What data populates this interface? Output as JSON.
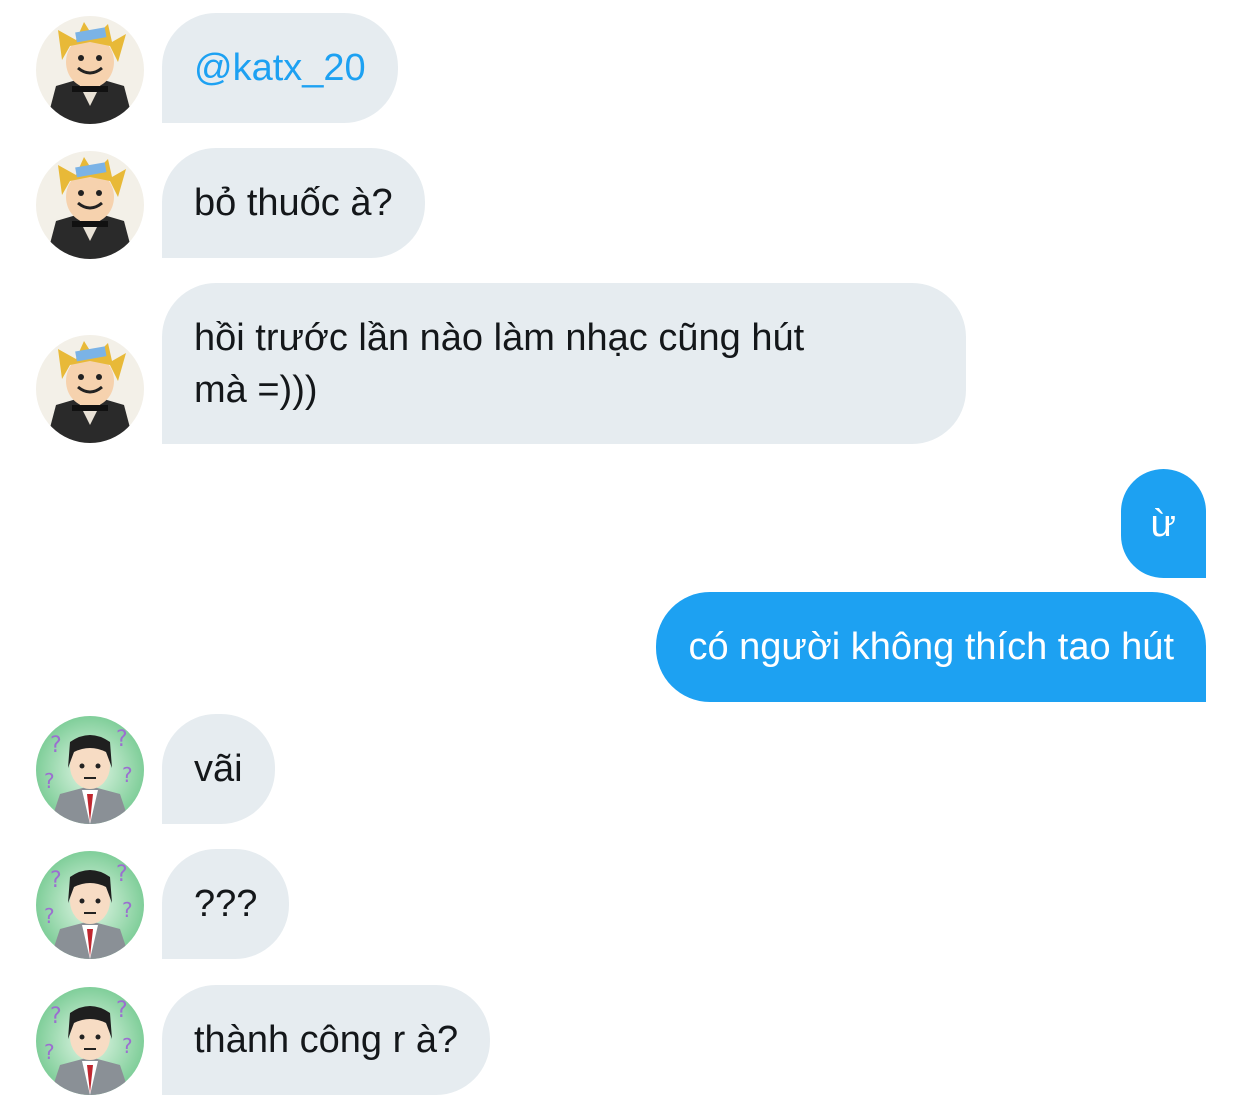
{
  "conversation": {
    "messages": [
      {
        "sender": "them",
        "avatar": "blonde-anime-avatar",
        "text": "@katx_20"
      },
      {
        "sender": "them",
        "avatar": "blonde-anime-avatar",
        "text": "bỏ thuốc à?"
      },
      {
        "sender": "them",
        "avatar": "blonde-anime-avatar",
        "text": "hồi trước lần nào làm nhạc cũng hút\nmà =)))"
      },
      {
        "sender": "me",
        "text": "ừ"
      },
      {
        "sender": "me",
        "text": "có người không thích tao hút"
      },
      {
        "sender": "them",
        "avatar": "black-hair-anime-avatar",
        "text": "vãi"
      },
      {
        "sender": "them",
        "avatar": "black-hair-anime-avatar",
        "text": "???"
      },
      {
        "sender": "them",
        "avatar": "black-hair-anime-avatar",
        "text": "thành công r à?"
      }
    ]
  },
  "colors": {
    "incoming_bubble": "#e6ecf0",
    "outgoing_bubble": "#1da1f2",
    "mention": "#1da1f2",
    "text": "#14171a"
  }
}
